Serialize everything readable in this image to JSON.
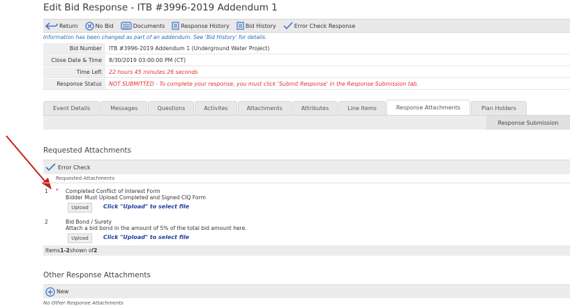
{
  "page": {
    "title": "Edit Bid Response - ITB #3996-2019 Addendum 1"
  },
  "toolbar": {
    "return_label": "Return",
    "nobid_label": "No Bid",
    "documents_label": "Documents",
    "response_history_label": "Response History",
    "bid_history_label": "Bid History",
    "error_check_label": "Error Check Response"
  },
  "info_message": "Information has been changed as part of an addendum. See 'Bid History' for details.",
  "fields": [
    {
      "label": "Bid Number",
      "value": "ITB #3996-2019 Addendum 1 (Underground Water Project)"
    },
    {
      "label": "Close Date & Time",
      "value": "8/30/2019 03:00:00 PM (CT)"
    },
    {
      "label": "Time Left",
      "value": "22 hours 45 minutes 26 seconds"
    },
    {
      "label": "Response Status",
      "value": "NOT SUBMITTED - To complete your response, you must click 'Submit Response' in the Response Submission tab."
    }
  ],
  "tabs": [
    "Event Details",
    "Messages",
    "Questions",
    "Activites",
    "Attachments",
    "Attributes",
    "Line Items",
    "Response Attachments",
    "Plan Holders"
  ],
  "subtab": "Response Submission",
  "requested": {
    "title": "Requested Attachments",
    "error_check": "Error Check",
    "column_header": "Requested Attachments",
    "rows": [
      {
        "num": "1",
        "required": "*",
        "name": "Completed Conflict of Interest Form",
        "desc": "Bidder Must Upload Completed and Signed CIQ Form",
        "upload": "Upload",
        "link": "Click \"Upload\" to select file"
      },
      {
        "num": "2",
        "required": "",
        "name": "Bid Bond / Surety",
        "desc": "Attach a bid bond in the amount of 5% of the total bid amount here.",
        "upload": "Upload",
        "link": "Click \"Upload\" to select file"
      }
    ],
    "footer_prefix": "Items ",
    "footer_range": "1-2",
    "footer_mid": " shown of ",
    "footer_total": "2"
  },
  "other": {
    "title": "Other Response Attachments",
    "new_label": "New",
    "empty": "No Other Response Attachments"
  },
  "colors": {
    "accent_blue": "#3f74c8",
    "required_red": "#d9261c",
    "arrow_red": "#c8201a"
  }
}
